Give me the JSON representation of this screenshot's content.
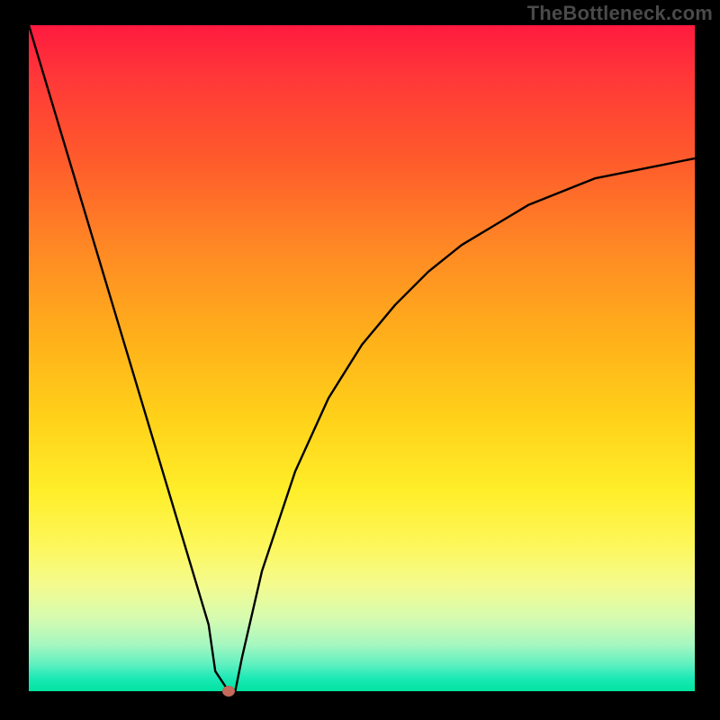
{
  "watermark": "TheBottleneck.com",
  "colors": {
    "background": "#000000",
    "gradient_top": "#ff1a3f",
    "gradient_bottom": "#00e3a0",
    "curve": "#000000",
    "marker": "#c46a5c"
  },
  "chart_data": {
    "type": "line",
    "title": "",
    "xlabel": "",
    "ylabel": "",
    "xlim": [
      0,
      100
    ],
    "ylim": [
      0,
      100
    ],
    "notes": "Single V-shaped bottleneck curve on a vertical red→green gradient. Minimum (optimal balance / 0% bottleneck) at x≈30. Left branch rises very steeply to ~100% at x=0; right branch rises with decreasing slope toward ~80% at x=100. A small reddish marker sits at the minimum.",
    "series": [
      {
        "name": "bottleneck-curve",
        "x": [
          0,
          3,
          6,
          9,
          12,
          15,
          18,
          21,
          24,
          27,
          28,
          30,
          31,
          32,
          35,
          40,
          45,
          50,
          55,
          60,
          65,
          70,
          75,
          80,
          85,
          90,
          95,
          100
        ],
        "values": [
          100,
          90,
          80,
          70,
          60,
          50,
          40,
          30,
          20,
          10,
          3,
          0,
          0,
          5,
          18,
          33,
          44,
          52,
          58,
          63,
          67,
          70,
          73,
          75,
          77,
          78,
          79,
          80
        ]
      }
    ],
    "marker": {
      "x": 30,
      "y": 0
    }
  }
}
